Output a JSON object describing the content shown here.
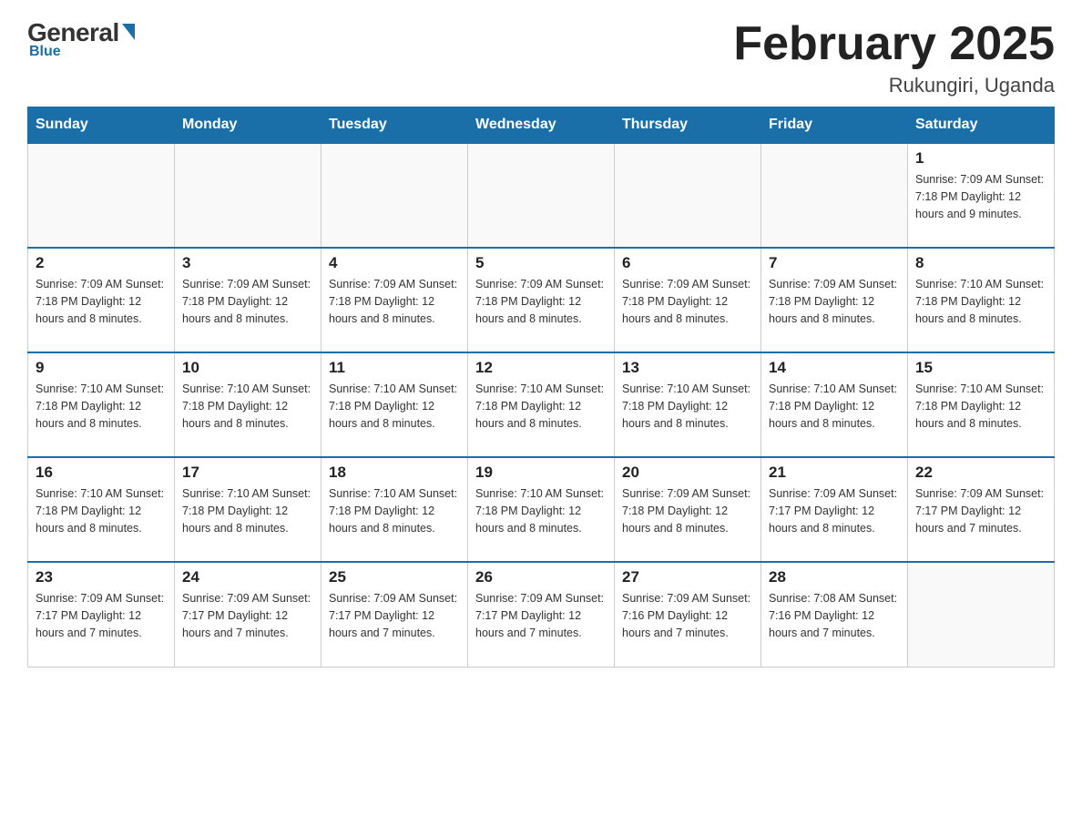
{
  "logo": {
    "general": "General",
    "blue": "Blue",
    "subtitle": "Blue"
  },
  "header": {
    "month_title": "February 2025",
    "location": "Rukungiri, Uganda"
  },
  "days_of_week": [
    "Sunday",
    "Monday",
    "Tuesday",
    "Wednesday",
    "Thursday",
    "Friday",
    "Saturday"
  ],
  "weeks": [
    [
      {
        "day": "",
        "info": ""
      },
      {
        "day": "",
        "info": ""
      },
      {
        "day": "",
        "info": ""
      },
      {
        "day": "",
        "info": ""
      },
      {
        "day": "",
        "info": ""
      },
      {
        "day": "",
        "info": ""
      },
      {
        "day": "1",
        "info": "Sunrise: 7:09 AM\nSunset: 7:18 PM\nDaylight: 12 hours and 9 minutes."
      }
    ],
    [
      {
        "day": "2",
        "info": "Sunrise: 7:09 AM\nSunset: 7:18 PM\nDaylight: 12 hours and 8 minutes."
      },
      {
        "day": "3",
        "info": "Sunrise: 7:09 AM\nSunset: 7:18 PM\nDaylight: 12 hours and 8 minutes."
      },
      {
        "day": "4",
        "info": "Sunrise: 7:09 AM\nSunset: 7:18 PM\nDaylight: 12 hours and 8 minutes."
      },
      {
        "day": "5",
        "info": "Sunrise: 7:09 AM\nSunset: 7:18 PM\nDaylight: 12 hours and 8 minutes."
      },
      {
        "day": "6",
        "info": "Sunrise: 7:09 AM\nSunset: 7:18 PM\nDaylight: 12 hours and 8 minutes."
      },
      {
        "day": "7",
        "info": "Sunrise: 7:09 AM\nSunset: 7:18 PM\nDaylight: 12 hours and 8 minutes."
      },
      {
        "day": "8",
        "info": "Sunrise: 7:10 AM\nSunset: 7:18 PM\nDaylight: 12 hours and 8 minutes."
      }
    ],
    [
      {
        "day": "9",
        "info": "Sunrise: 7:10 AM\nSunset: 7:18 PM\nDaylight: 12 hours and 8 minutes."
      },
      {
        "day": "10",
        "info": "Sunrise: 7:10 AM\nSunset: 7:18 PM\nDaylight: 12 hours and 8 minutes."
      },
      {
        "day": "11",
        "info": "Sunrise: 7:10 AM\nSunset: 7:18 PM\nDaylight: 12 hours and 8 minutes."
      },
      {
        "day": "12",
        "info": "Sunrise: 7:10 AM\nSunset: 7:18 PM\nDaylight: 12 hours and 8 minutes."
      },
      {
        "day": "13",
        "info": "Sunrise: 7:10 AM\nSunset: 7:18 PM\nDaylight: 12 hours and 8 minutes."
      },
      {
        "day": "14",
        "info": "Sunrise: 7:10 AM\nSunset: 7:18 PM\nDaylight: 12 hours and 8 minutes."
      },
      {
        "day": "15",
        "info": "Sunrise: 7:10 AM\nSunset: 7:18 PM\nDaylight: 12 hours and 8 minutes."
      }
    ],
    [
      {
        "day": "16",
        "info": "Sunrise: 7:10 AM\nSunset: 7:18 PM\nDaylight: 12 hours and 8 minutes."
      },
      {
        "day": "17",
        "info": "Sunrise: 7:10 AM\nSunset: 7:18 PM\nDaylight: 12 hours and 8 minutes."
      },
      {
        "day": "18",
        "info": "Sunrise: 7:10 AM\nSunset: 7:18 PM\nDaylight: 12 hours and 8 minutes."
      },
      {
        "day": "19",
        "info": "Sunrise: 7:10 AM\nSunset: 7:18 PM\nDaylight: 12 hours and 8 minutes."
      },
      {
        "day": "20",
        "info": "Sunrise: 7:09 AM\nSunset: 7:18 PM\nDaylight: 12 hours and 8 minutes."
      },
      {
        "day": "21",
        "info": "Sunrise: 7:09 AM\nSunset: 7:17 PM\nDaylight: 12 hours and 8 minutes."
      },
      {
        "day": "22",
        "info": "Sunrise: 7:09 AM\nSunset: 7:17 PM\nDaylight: 12 hours and 7 minutes."
      }
    ],
    [
      {
        "day": "23",
        "info": "Sunrise: 7:09 AM\nSunset: 7:17 PM\nDaylight: 12 hours and 7 minutes."
      },
      {
        "day": "24",
        "info": "Sunrise: 7:09 AM\nSunset: 7:17 PM\nDaylight: 12 hours and 7 minutes."
      },
      {
        "day": "25",
        "info": "Sunrise: 7:09 AM\nSunset: 7:17 PM\nDaylight: 12 hours and 7 minutes."
      },
      {
        "day": "26",
        "info": "Sunrise: 7:09 AM\nSunset: 7:17 PM\nDaylight: 12 hours and 7 minutes."
      },
      {
        "day": "27",
        "info": "Sunrise: 7:09 AM\nSunset: 7:16 PM\nDaylight: 12 hours and 7 minutes."
      },
      {
        "day": "28",
        "info": "Sunrise: 7:08 AM\nSunset: 7:16 PM\nDaylight: 12 hours and 7 minutes."
      },
      {
        "day": "",
        "info": ""
      }
    ]
  ]
}
